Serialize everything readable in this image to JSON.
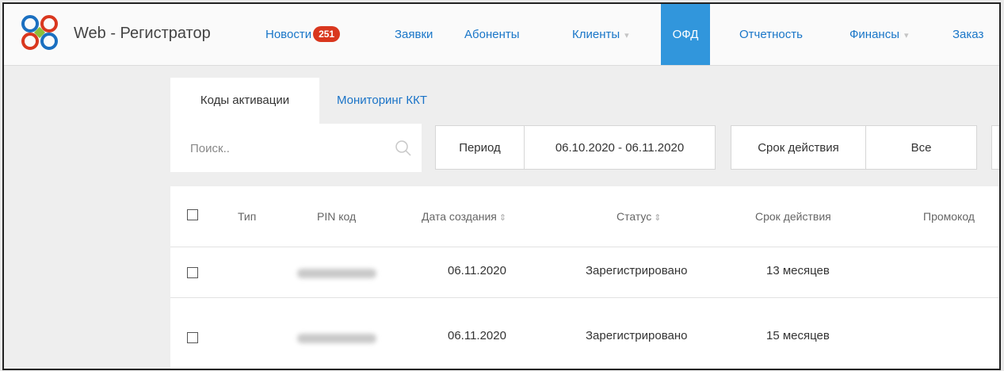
{
  "brand": {
    "title": "Web - Регистратор"
  },
  "nav": [
    {
      "label": "Новости",
      "badge": "251"
    },
    {
      "label": "Заявки"
    },
    {
      "label": "Абоненты"
    },
    {
      "label": "Клиенты",
      "dropdown": true
    },
    {
      "label": "ОФД",
      "active": true
    },
    {
      "label": "Отчетность"
    },
    {
      "label": "Финансы",
      "dropdown": true
    },
    {
      "label": "Заказ"
    }
  ],
  "tabs": [
    {
      "label": "Коды активации",
      "active": true
    },
    {
      "label": "Мониторинг ККТ"
    }
  ],
  "filters": {
    "search_placeholder": "Поиск..",
    "period_label": "Период",
    "period_value": "06.10.2020 - 06.11.2020",
    "validity_label": "Срок действия",
    "validity_value": "Все"
  },
  "table": {
    "columns": [
      "Тип",
      "PIN код",
      "Дата создания",
      "Статус",
      "Срок действия",
      "Промокод"
    ],
    "rows": [
      {
        "type": "",
        "pin": "",
        "created": "06.11.2020",
        "status": "Зарегистрировано",
        "validity": "13 месяцев",
        "promo": ""
      },
      {
        "type": "",
        "pin": "",
        "created": "06.11.2020",
        "status": "Зарегистрировано",
        "validity": "15 месяцев",
        "promo": ""
      }
    ]
  },
  "colors": {
    "accent": "#3196dc",
    "link": "#1976c8",
    "badge": "#d9371e"
  },
  "icons": [
    "logo-icon",
    "search-icon",
    "sort-icon",
    "chevron-down-icon",
    "checkbox"
  ]
}
